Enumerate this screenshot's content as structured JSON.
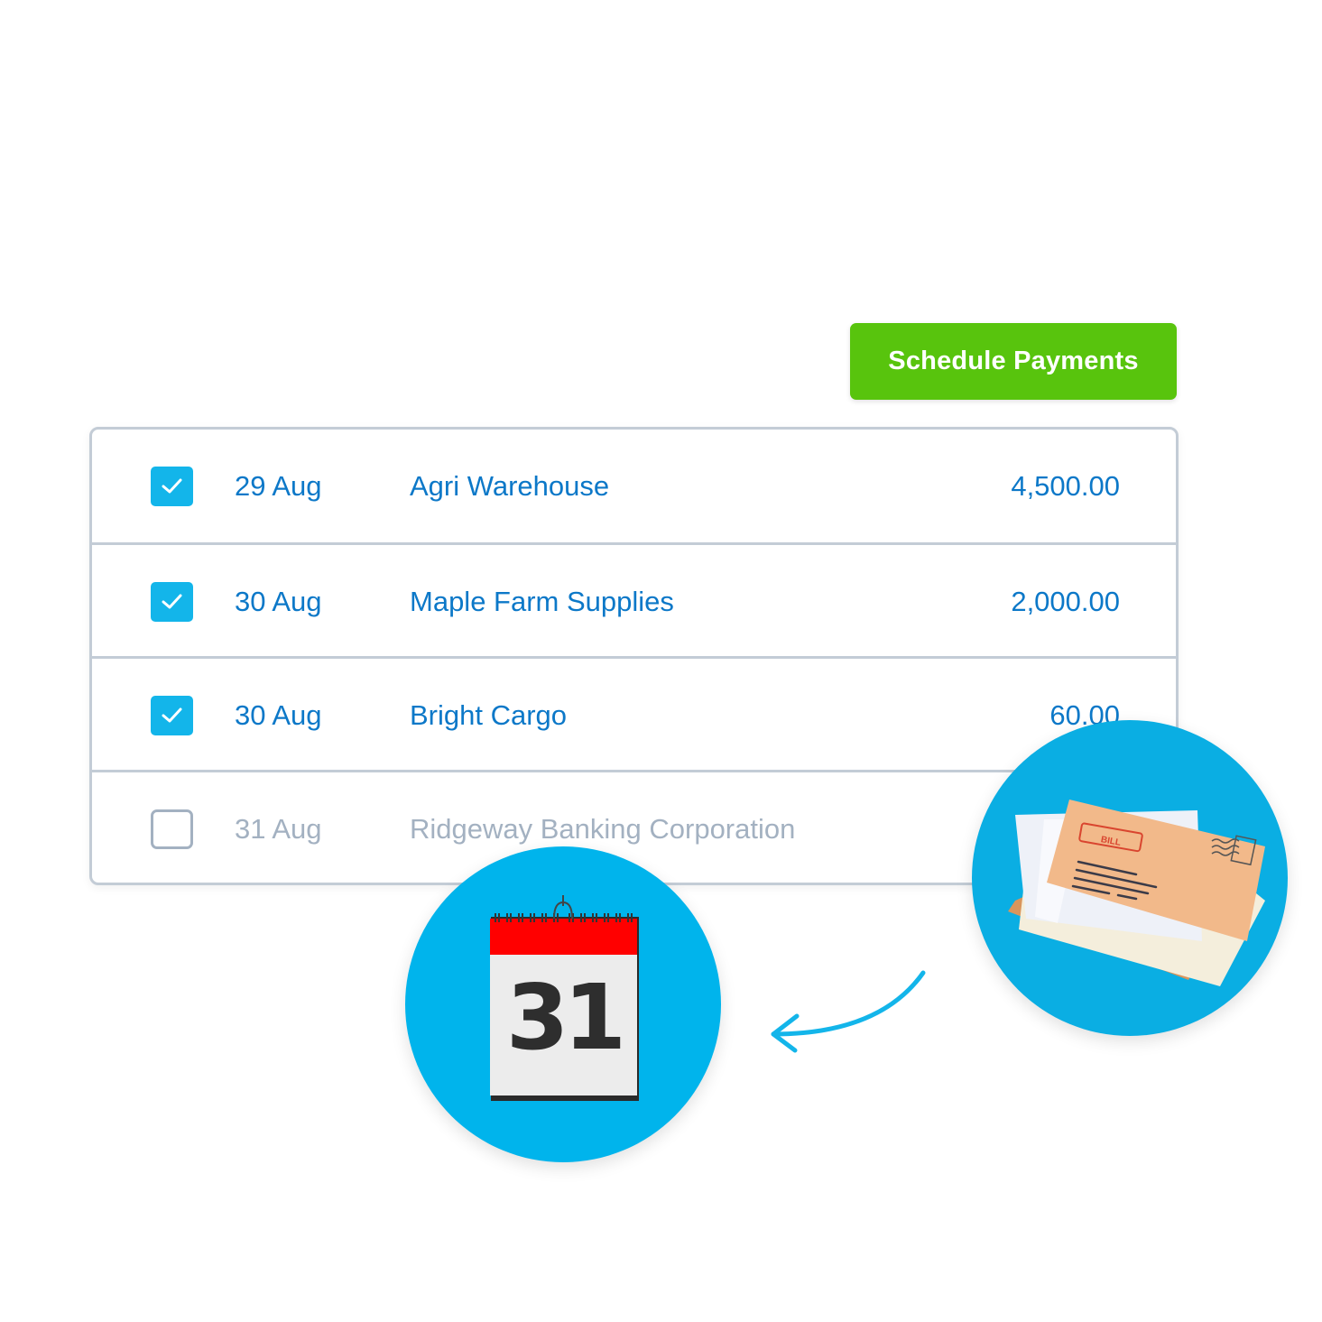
{
  "toolbar": {
    "schedule_label": "Schedule Payments",
    "accent_color": "#58c40d"
  },
  "payments": {
    "rows": [
      {
        "checked": true,
        "date": "29 Aug",
        "payee": "Agri Warehouse",
        "amount": "4,500.00"
      },
      {
        "checked": true,
        "date": "30 Aug",
        "payee": "Maple Farm Supplies",
        "amount": "2,000.00"
      },
      {
        "checked": true,
        "date": "30 Aug",
        "payee": "Bright Cargo",
        "amount": "60.00"
      },
      {
        "checked": false,
        "date": "31 Aug",
        "payee": "Ridgeway Banking Corporation",
        "amount": ""
      }
    ],
    "active_text_color": "#0c78c8",
    "inactive_text_color": "#a3b1c1",
    "checkbox_color": "#13b5ea"
  },
  "illustrations": {
    "calendar": {
      "icon": "calendar-icon",
      "day": "31"
    },
    "envelopes": {
      "icon": "envelope-stack-icon",
      "stamp_label": "BILL"
    },
    "arrow": {
      "icon": "curved-arrow-left-icon"
    }
  }
}
